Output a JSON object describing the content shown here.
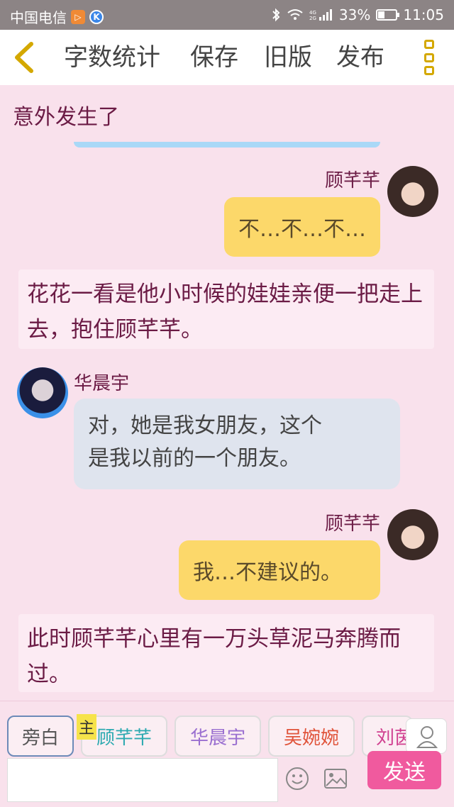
{
  "status_bar": {
    "carrier": "中国电信",
    "percent": "33%",
    "time": "11:05",
    "battery_level": 0.33,
    "icons": [
      "video-icon",
      "k-icon",
      "bluetooth-icon",
      "wifi-icon",
      "signal-icon",
      "battery-icon"
    ]
  },
  "toolbar": {
    "back_icon": "chevron-left-icon",
    "items": [
      "字数统计",
      "保存",
      "旧版",
      "发布"
    ],
    "menu_icon": "more-vertical-icon"
  },
  "chat": {
    "top_text": "意外发生了",
    "messages": [
      {
        "speaker": "顾芊芊",
        "text": "不…不…不…"
      },
      {
        "narration": "花花一看是他小时候的娃娃亲便一把走上去，抱住顾芊芊。"
      },
      {
        "speaker": "华晨宇",
        "text_line1": "对，她是我女朋友，这个",
        "text_line2": "是我以前的一个朋友。"
      },
      {
        "speaker": "顾芊芊",
        "text": "我…不建议的。"
      },
      {
        "narration": "此时顾芊芊心里有一万头草泥马奔腾而过。"
      }
    ]
  },
  "bottom": {
    "chips": [
      "旁白",
      "顾芊芊",
      "华晨宇",
      "吴婉婉",
      "刘茵"
    ],
    "chip_colors": [
      "#555555",
      "#2ba9b0",
      "#9a6fd0",
      "#e0533a",
      "#d04090"
    ],
    "main_tag": "主",
    "send_label": "发送"
  }
}
